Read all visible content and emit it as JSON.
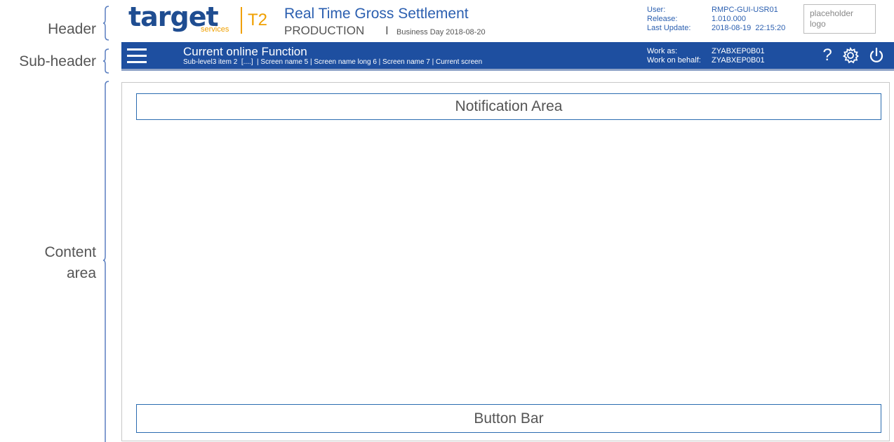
{
  "annotations": {
    "header": "Header",
    "subheader": "Sub-header",
    "content_line1": "Content",
    "content_line2": "area"
  },
  "header": {
    "logo_text": "target",
    "logo_services": "services",
    "logo_product": "T2",
    "app_title": "Real Time Gross Settlement",
    "environment": "PRODUCTION",
    "env_separator": "I",
    "business_day": "Business Day 2018-08-20",
    "user_label": "User:",
    "user_value": "RMPC-GUI-USR01",
    "release_label": "Release:",
    "release_value": "1.010.000",
    "last_update_label": "Last Update:",
    "last_update_value": "2018-08-19  22:15:20",
    "placeholder_logo_line1": "placeholder",
    "placeholder_logo_line2": "logo"
  },
  "subheader": {
    "function_title": "Current online Function",
    "breadcrumb": "Sub-level3 item 2  [....]  | Screen name 5 | Screen name long 6 | Screen name 7 | Current screen",
    "work_as_label": "Work as:",
    "work_as_value": "ZYABXEP0B01",
    "work_on_behalf_label": "Work on behalf:",
    "work_on_behalf_value": "ZYABXEP0B01",
    "help_glyph": "?",
    "icons": [
      "menu-icon",
      "help-icon",
      "settings-icon",
      "power-icon"
    ]
  },
  "content": {
    "notification_area": "Notification Area",
    "button_bar": "Button Bar"
  },
  "colors": {
    "brand_blue": "#1e4fa0",
    "accent_orange": "#f0a000",
    "title_blue": "#2b5fb0"
  }
}
